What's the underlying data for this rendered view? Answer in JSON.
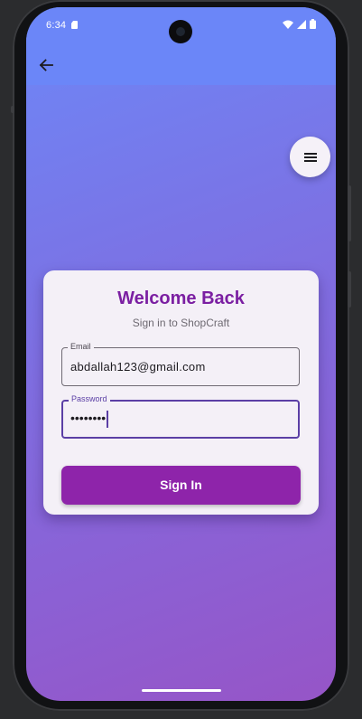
{
  "status_bar": {
    "time": "6:34"
  },
  "app_bar": {
    "back_icon": "arrow-back-icon"
  },
  "menu_button": {
    "icon": "menu-icon"
  },
  "login_card": {
    "title": "Welcome Back",
    "subtitle": "Sign in to ShopCraft",
    "email": {
      "label": "Email",
      "value": "abdallah123@gmail.com"
    },
    "password": {
      "label": "Password",
      "value": "••••••••"
    },
    "submit_label": "Sign In"
  },
  "colors": {
    "gradient_start": "#6d87f7",
    "gradient_end": "#9655c7",
    "app_bar": "#6b86f8",
    "title": "#7b1fa2",
    "button": "#8e24aa",
    "focused_border": "#5b3fa5",
    "card": "#f4f0f7"
  }
}
